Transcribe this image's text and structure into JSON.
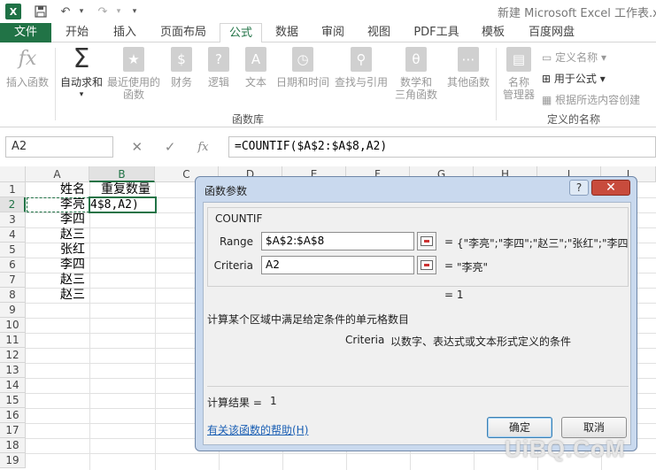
{
  "window": {
    "title": "新建 Microsoft Excel 工作表.xls"
  },
  "ribbon_tabs": [
    "文件",
    "开始",
    "插入",
    "页面布局",
    "公式",
    "数据",
    "审阅",
    "视图",
    "PDF工具",
    "模板",
    "百度网盘"
  ],
  "active_tab": "公式",
  "ribbon": {
    "insert_function": "插入函数",
    "autosum": "自动求和",
    "recent": [
      "最近使用的",
      "函数"
    ],
    "financial": "财务",
    "logical": "逻辑",
    "text": "文本",
    "datetime": "日期和时间",
    "lookup": "查找与引用",
    "math": [
      "数学和",
      "三角函数"
    ],
    "more": "其他函数",
    "library_label": "函数库",
    "name_manager": [
      "名称",
      "管理器"
    ],
    "define_name": "定义名称",
    "use_in_formula": "用于公式",
    "create_from_selection": "根据所选内容创建",
    "defined_names_label": "定义的名称"
  },
  "formula_bar": {
    "name_box": "A2",
    "formula": "=COUNTIF($A$2:$A$8,A2)"
  },
  "columns": [
    "A",
    "B",
    "C",
    "D",
    "E",
    "F",
    "G",
    "H",
    "I",
    "J"
  ],
  "rows": [
    "1",
    "2",
    "3",
    "4",
    "5",
    "6",
    "7",
    "8",
    "9",
    "10",
    "11",
    "12",
    "13",
    "14",
    "15",
    "16",
    "17",
    "18",
    "19"
  ],
  "cells": {
    "A1": "姓名",
    "B1": "重复数量",
    "A2": "李亮",
    "B2_edit": "4$8,A2)",
    "A3": "李四",
    "A4": "赵三",
    "A5": "张红",
    "A6": "李四",
    "A7": "赵三",
    "A8": "赵三"
  },
  "dialog": {
    "title": "函数参数",
    "help_btn": "?",
    "close_btn": "✕",
    "function_name": "COUNTIF",
    "args": [
      {
        "label": "Range",
        "value": "$A$2:$A$8",
        "result": "{\"李亮\";\"李四\";\"赵三\";\"张红\";\"李四"
      },
      {
        "label": "Criteria",
        "value": "A2",
        "result": "\"李亮\""
      }
    ],
    "eq": "=",
    "formula_result": "= 1",
    "description": "计算某个区域中满足给定条件的单元格数目",
    "criteria_name": "Criteria",
    "criteria_desc": "以数字、表达式或文本形式定义的条件",
    "calc_result_label": "计算结果 =",
    "calc_result_value": "1",
    "help_link": "有关该函数的帮助(H)",
    "ok": "确定",
    "cancel": "取消"
  },
  "watermark": "UiBQ.CoM"
}
